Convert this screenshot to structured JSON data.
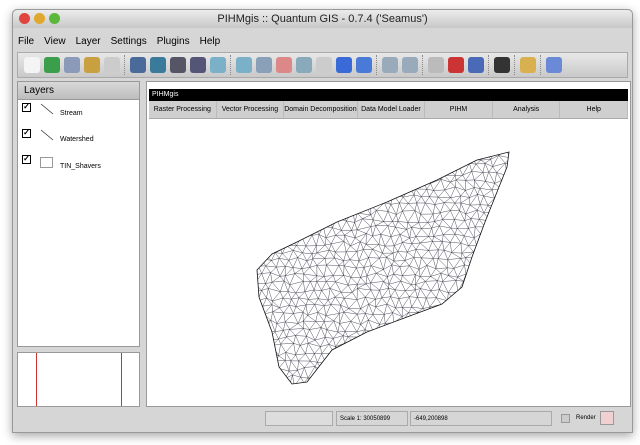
{
  "window": {
    "title": "PIHMgis :: Quantum GIS - 0.7.4 ('Seamus')"
  },
  "menu": [
    "File",
    "View",
    "Layer",
    "Settings",
    "Plugins",
    "Help"
  ],
  "toolbar_icons": [
    "new-project",
    "open-project",
    "save-project",
    "save-as",
    "print",
    "add-raster",
    "add-vector",
    "show-layer",
    "hide-layer",
    "zoom-in",
    "zoom-out",
    "zoom-full",
    "zoom-select",
    "zoom-layer",
    "pan",
    "zoom-last",
    "refresh",
    "identify",
    "select",
    "measure",
    "capture",
    "attribute-table",
    "whats-this",
    "plugin-a",
    "plugin-b"
  ],
  "layers": {
    "title": "Layers",
    "items": [
      {
        "name": "Stream",
        "checked": true
      },
      {
        "name": "Watershed",
        "checked": true
      },
      {
        "name": "TIN_Shavers",
        "checked": true
      }
    ]
  },
  "pihm": {
    "title": "PIHMgis",
    "menus": [
      "Raster Processing",
      "Vector Processing",
      "Domain Decomposition",
      "Data Model Loader",
      "PIHM",
      "Analysis",
      "Help"
    ]
  },
  "status": {
    "progress": "",
    "scale": "Scale 1: 30050899",
    "coords": "-649,200898",
    "render_label": "Render"
  }
}
